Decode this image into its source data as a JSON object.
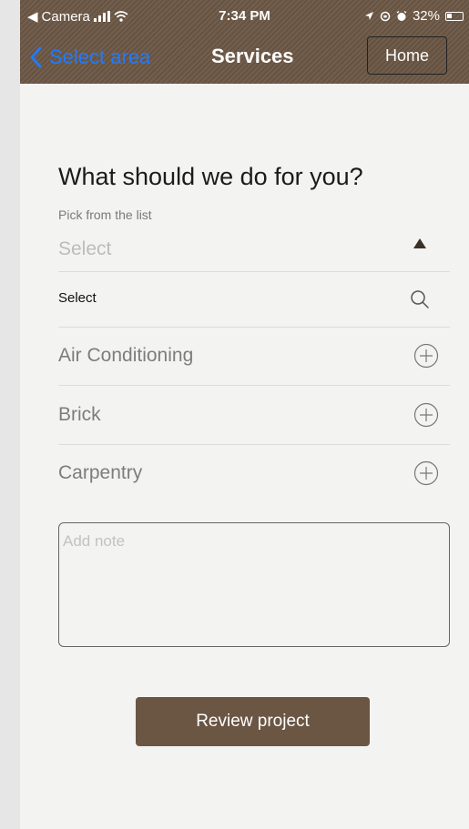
{
  "status_bar": {
    "back_app": "Camera",
    "time": "7:34 PM",
    "battery": "32%"
  },
  "nav": {
    "back_label": "Select area",
    "title": "Services",
    "home_label": "Home"
  },
  "form": {
    "heading": "What should we do for you?",
    "picker_label": "Pick from the list",
    "select_value": "Select",
    "search_placeholder": "Select",
    "options": [
      {
        "label": "Air Conditioning"
      },
      {
        "label": "Brick"
      },
      {
        "label": "Carpentry"
      }
    ],
    "note_placeholder": "Add note",
    "review_label": "Review project"
  },
  "colors": {
    "brand_brown": "#6b5644",
    "ios_blue": "#1f7bff"
  }
}
